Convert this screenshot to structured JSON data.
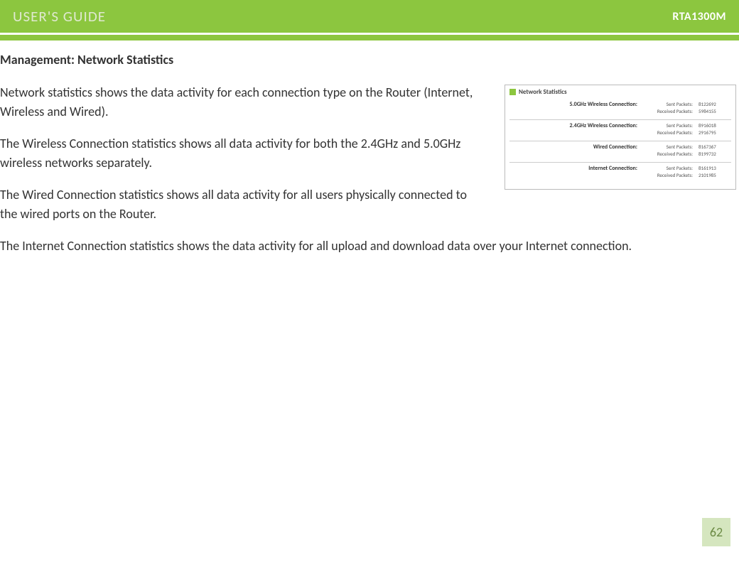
{
  "banner": {
    "title": "USER'S GUIDE",
    "model": "RTA1300M"
  },
  "section_title": "Management: Network Statistics",
  "paragraphs": [
    "Network statistics shows the data activity for each connection type on the Router (Internet, Wireless and Wired).",
    "The Wireless Connection statistics shows all data activity for both the 2.4GHz and 5.0GHz wireless networks separately.",
    "The Wired Connection statistics shows all data activity for all users physically connected to the wired ports on the Router.",
    "The Internet Connection statistics shows the data activity for all upload and download data over your Internet connection."
  ],
  "figure": {
    "heading": "Network Statistics",
    "labels": {
      "sent": "Sent Packets:",
      "recv": "Received Packets:"
    },
    "sections": [
      {
        "name": "5.0GHz Wireless Connection:",
        "sent": "8122692",
        "recv": "5984155"
      },
      {
        "name": "2.4GHz Wireless Connection:",
        "sent": "8916018",
        "recv": "2916795"
      },
      {
        "name": "Wired Connection:",
        "sent": "8167367",
        "recv": "8199732"
      },
      {
        "name": "Internet Connection:",
        "sent": "8161913",
        "recv": "2101985"
      }
    ]
  },
  "page_number": "62"
}
